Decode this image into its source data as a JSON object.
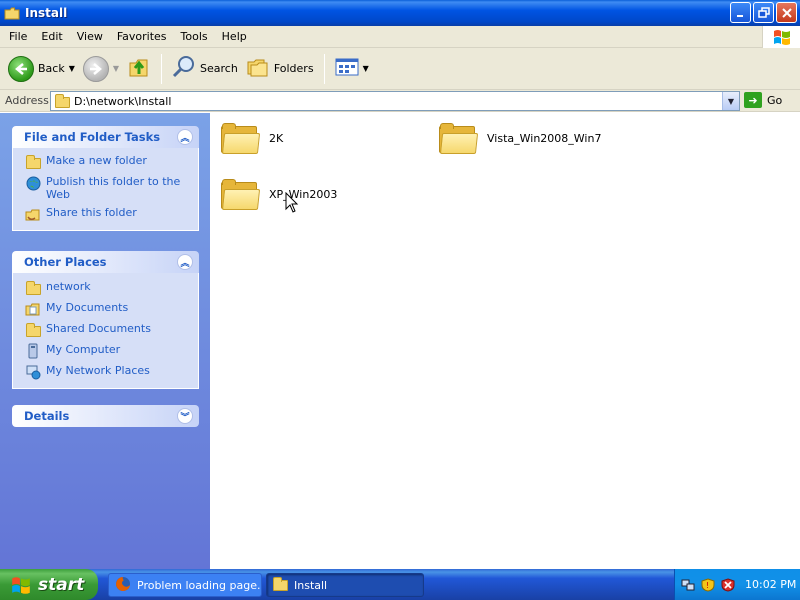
{
  "window": {
    "title": "Install"
  },
  "menu": [
    "File",
    "Edit",
    "View",
    "Favorites",
    "Tools",
    "Help"
  ],
  "toolbar": {
    "back": "Back",
    "search": "Search",
    "folders": "Folders"
  },
  "address": {
    "label": "Address",
    "path": "D:\\network\\Install",
    "go": "Go"
  },
  "panels": {
    "tasks": {
      "title": "File and Folder Tasks",
      "items": [
        "Make a new folder",
        "Publish this folder to the Web",
        "Share this folder"
      ]
    },
    "places": {
      "title": "Other Places",
      "items": [
        "network",
        "My Documents",
        "Shared Documents",
        "My Computer",
        "My Network Places"
      ]
    },
    "details": {
      "title": "Details"
    }
  },
  "folders": [
    "2K",
    "Vista_Win2008_Win7",
    "XP_Win2003"
  ],
  "taskbar": {
    "start": "start",
    "buttons": [
      "Problem loading page...",
      "Install"
    ],
    "clock": "10:02 PM"
  },
  "colors": {
    "titlebar": "#0054e3",
    "start": "#3a9a36",
    "panel_link": "#215dc6"
  }
}
